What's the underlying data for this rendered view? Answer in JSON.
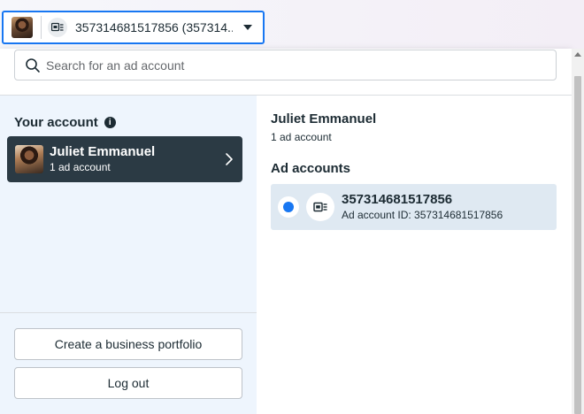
{
  "selector": {
    "account_text": "357314681517856 (357314...",
    "avatar_icon": "profile-photo",
    "account_icon": "ad-account-icon",
    "caret_icon": "caret-down-icon"
  },
  "search": {
    "placeholder": "Search for an ad account",
    "icon": "search-icon"
  },
  "your_account": {
    "heading": "Your account",
    "info_icon": "i",
    "card": {
      "name": "Juliet Emmanuel",
      "subtitle": "1 ad account"
    }
  },
  "buttons": {
    "create_portfolio": "Create a business portfolio",
    "log_out": "Log out"
  },
  "details": {
    "name": "Juliet Emmanuel",
    "count": "1 ad account",
    "section_heading": "Ad accounts",
    "ad_accounts": [
      {
        "name": "357314681517856",
        "id_text": "Ad account ID: 357314681517856",
        "selected": true
      }
    ]
  },
  "colors": {
    "accent": "#1877f2",
    "card_dark": "#2b3a44",
    "left_bg": "#eef5fd",
    "selected_row": "#dfe9f2"
  }
}
